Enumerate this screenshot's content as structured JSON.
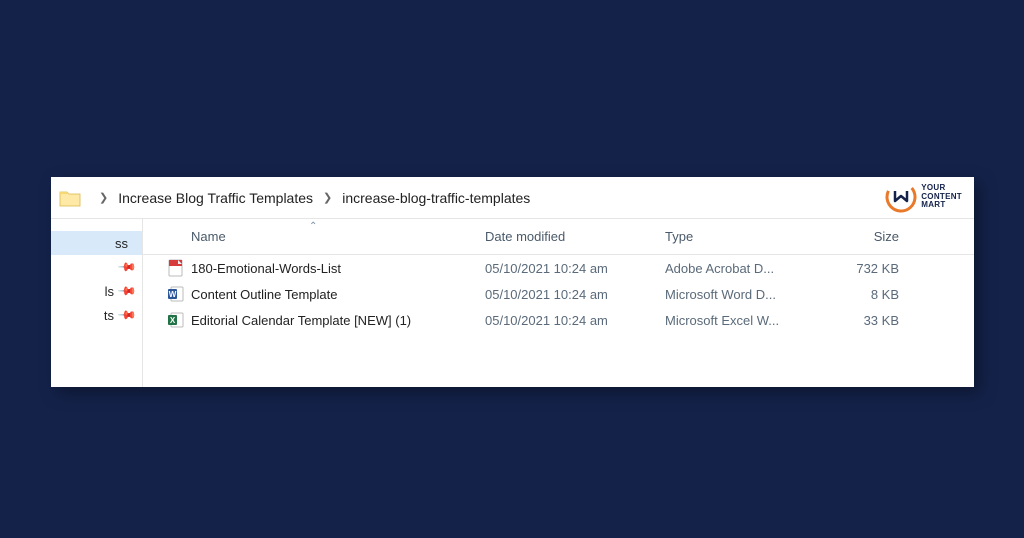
{
  "breadcrumb": {
    "parts": [
      "Increase Blog Traffic Templates",
      "increase-blog-traffic-templates"
    ]
  },
  "logo": {
    "line1": "YOUR",
    "line2": "CONTENT",
    "line3": "MART"
  },
  "nav": {
    "items": [
      {
        "label": "ss",
        "pinned": false,
        "selected": true
      },
      {
        "label": "",
        "pinned": true,
        "selected": false
      },
      {
        "label": "ls",
        "pinned": true,
        "selected": false
      },
      {
        "label": "ts",
        "pinned": true,
        "selected": false
      }
    ]
  },
  "columns": {
    "name": "Name",
    "date": "Date modified",
    "type": "Type",
    "size": "Size"
  },
  "files": [
    {
      "icon": "pdf",
      "name": "180-Emotional-Words-List",
      "date": "05/10/2021 10:24 am",
      "type": "Adobe Acrobat D...",
      "size": "732 KB"
    },
    {
      "icon": "word",
      "name": "Content Outline Template",
      "date": "05/10/2021 10:24 am",
      "type": "Microsoft Word D...",
      "size": "8 KB"
    },
    {
      "icon": "excel",
      "name": "Editorial Calendar Template [NEW] (1)",
      "date": "05/10/2021 10:24 am",
      "type": "Microsoft Excel W...",
      "size": "33 KB"
    }
  ]
}
